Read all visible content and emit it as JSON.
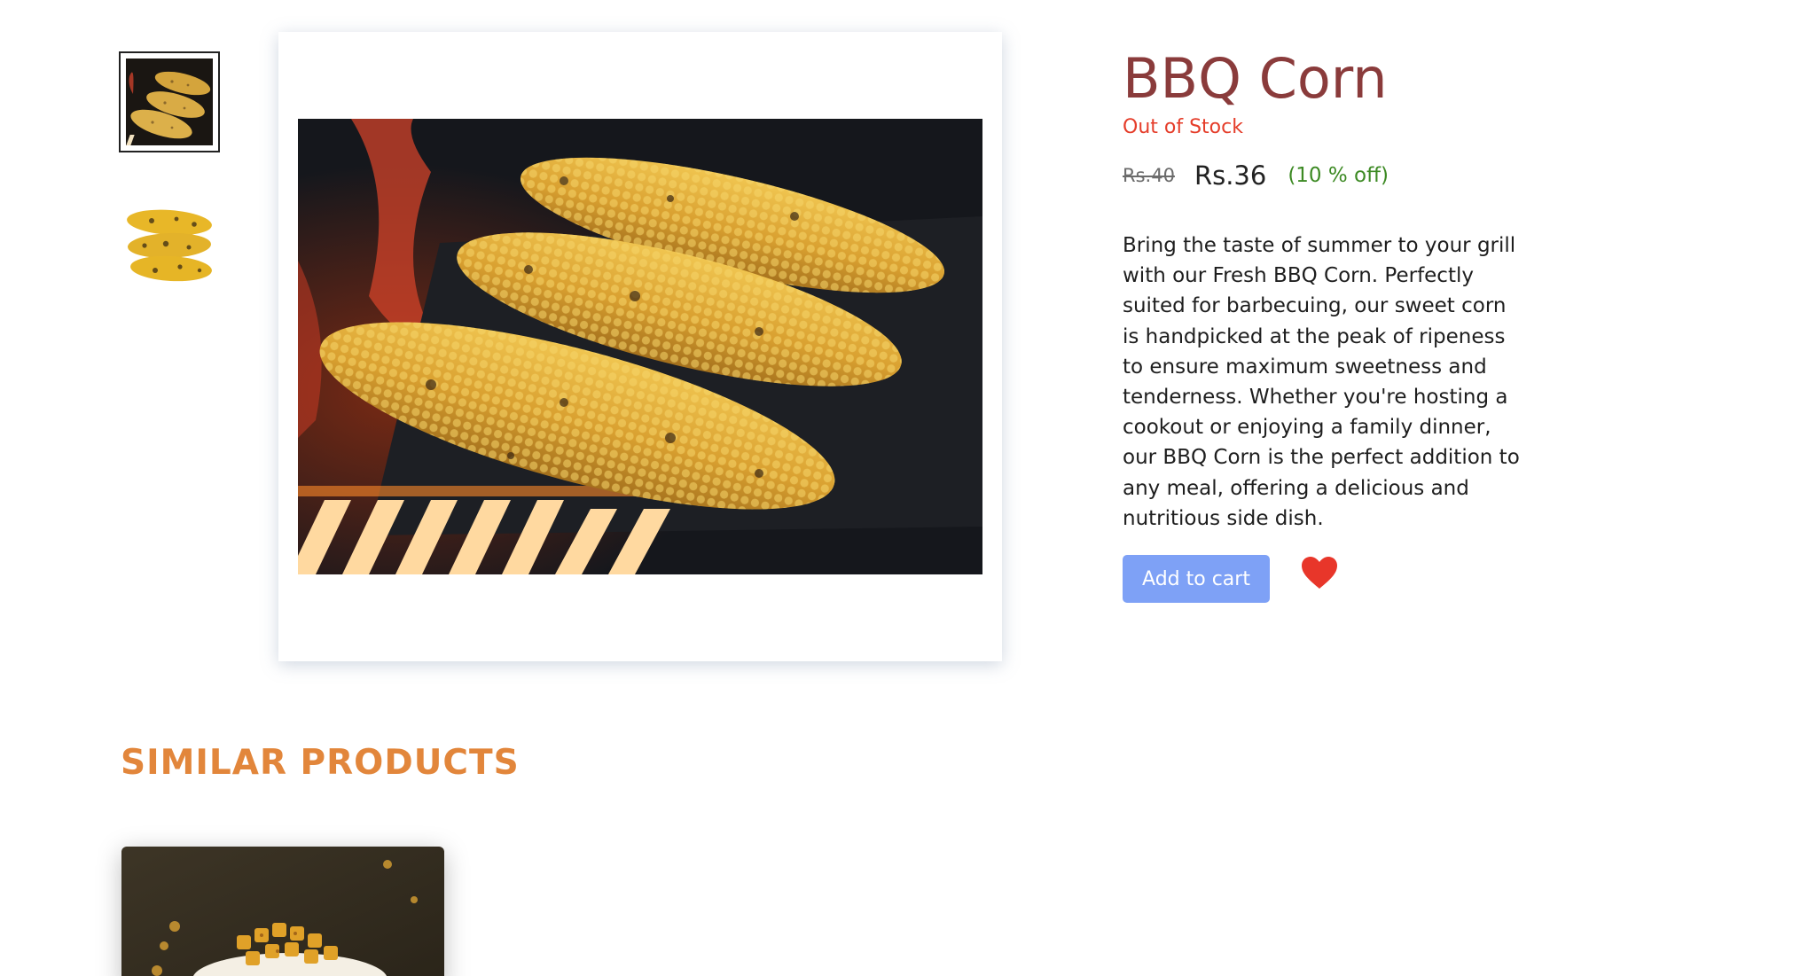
{
  "product": {
    "title": "BBQ Corn",
    "stock_status": "Out of Stock",
    "original_price": "Rs.40",
    "price": "Rs.36",
    "discount": "(10 % off)",
    "description": "Bring the taste of summer to your grill with our Fresh BBQ Corn. Perfectly suited for barbecuing, our sweet corn is handpicked at the peak of ripeness to ensure maximum sweetness and tenderness. Whether you're hosting a cookout or enjoying a family dinner, our BBQ Corn is the perfect addition to any meal, offering a delicious and nutritious side dish.",
    "add_to_cart_label": "Add to cart",
    "wishlist_icon": "heart-icon"
  },
  "gallery": {
    "thumbnails": [
      {
        "name": "grilled-corn-on-grill",
        "selected": true
      },
      {
        "name": "charred-corn-stack",
        "selected": false
      }
    ],
    "main_image": "grilled-corn-on-grill"
  },
  "similar": {
    "title": "SIMILAR PRODUCTS",
    "items": [
      {
        "image": "spiced-corn-bowl"
      }
    ]
  },
  "colors": {
    "title": "#8a3b3b",
    "out_of_stock": "#e53d2a",
    "discount": "#3d8a24",
    "button": "#7ea1f6",
    "heart": "#e8362a",
    "section_title": "#e2863b"
  }
}
